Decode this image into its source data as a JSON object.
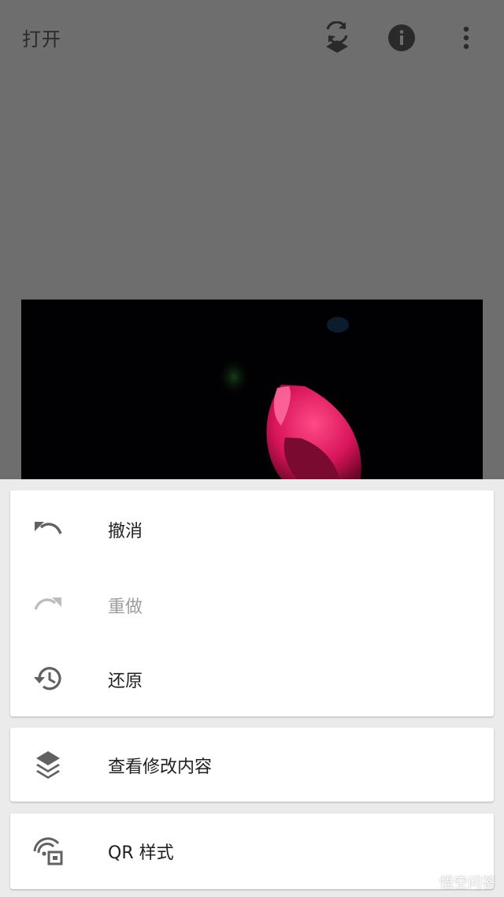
{
  "topbar": {
    "open_label": "打开",
    "icons": [
      "layers-rotate-icon",
      "info-icon",
      "more-vert-icon"
    ]
  },
  "menu": {
    "group1": [
      {
        "label": "撤消",
        "icon": "undo-icon",
        "enabled": true
      },
      {
        "label": "重做",
        "icon": "redo-icon",
        "enabled": false
      },
      {
        "label": "还原",
        "icon": "history-icon",
        "enabled": true
      }
    ],
    "group2": [
      {
        "label": "查看修改内容",
        "icon": "layers-icon",
        "enabled": true
      }
    ],
    "group3": [
      {
        "label": "QR 样式",
        "icon": "qr-style-icon",
        "enabled": true
      }
    ]
  },
  "watermark": {
    "logo": "wukong-logo",
    "text": "悟空问答"
  },
  "colors": {
    "overlay": "#6e6e6e",
    "sheet_bg": "#ebebeb",
    "card_bg": "#ffffff",
    "icon_gray": "#616161",
    "disabled_gray": "#9e9e9e",
    "flower_pink": "#e0175f"
  }
}
